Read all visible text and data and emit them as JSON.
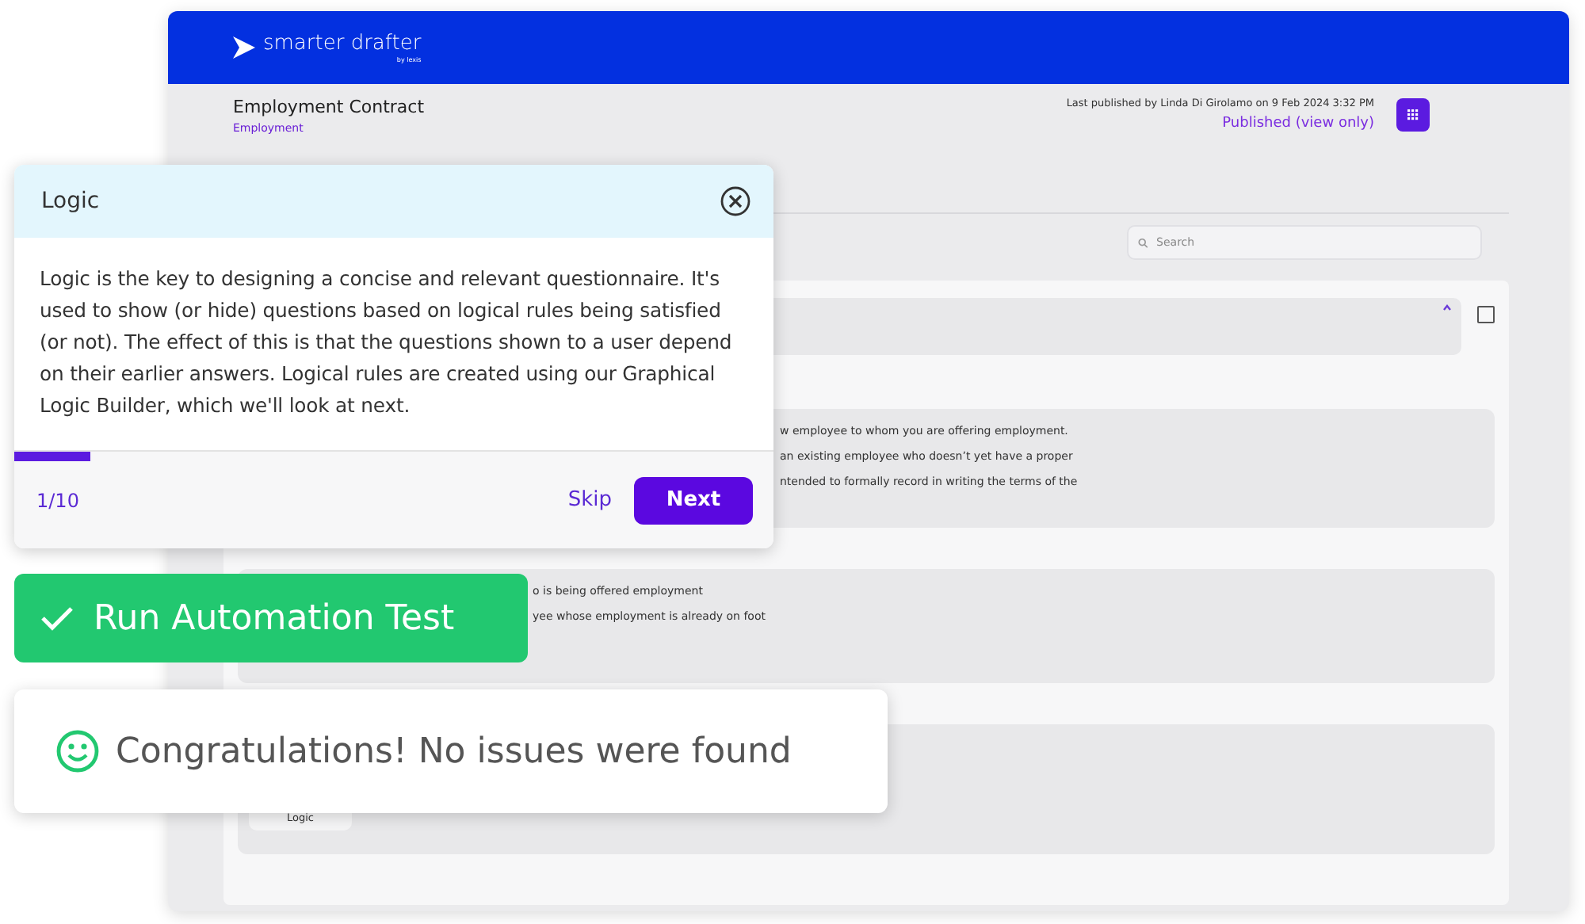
{
  "app": {
    "logo": "smarter drafter",
    "logo_byline": "by lexis",
    "document_title": "Employment Contract",
    "document_category": "Employment",
    "published_info": "Last published by Linda Di Girolamo on 9 Feb 2024 3:32 PM",
    "status_link": "Published (view only)",
    "search": {
      "placeholder": "Search"
    },
    "cards": [
      {
        "kind": "header",
        "checked": false
      },
      {
        "kind": "text",
        "lines": [
          "w employee to whom you are offering employment.",
          "an existing employee who doesn’t yet have a proper",
          "ntended to formally record in writing the terms of the"
        ]
      },
      {
        "kind": "text",
        "lines": [
          "o is being offered employment",
          "yee whose employment is already on foot"
        ]
      },
      {
        "kind": "chips",
        "chips": [
          "Logic"
        ]
      }
    ]
  },
  "tour": {
    "title": "Logic",
    "body": "Logic is the key to designing a concise and relevant questionnaire. It's used to show (or hide) questions based on logical rules being satisfied (or not). The effect of this is that the questions shown to a user depend on their earlier answers. Logical rules are created using our Graphical Logic Builder, which we'll look at next.",
    "step": "1/10",
    "level": 0.1,
    "skip": "Skip",
    "next": "Next"
  },
  "automation_button": "Run Automation Test",
  "result_message": "Congratulations! No issues were found"
}
